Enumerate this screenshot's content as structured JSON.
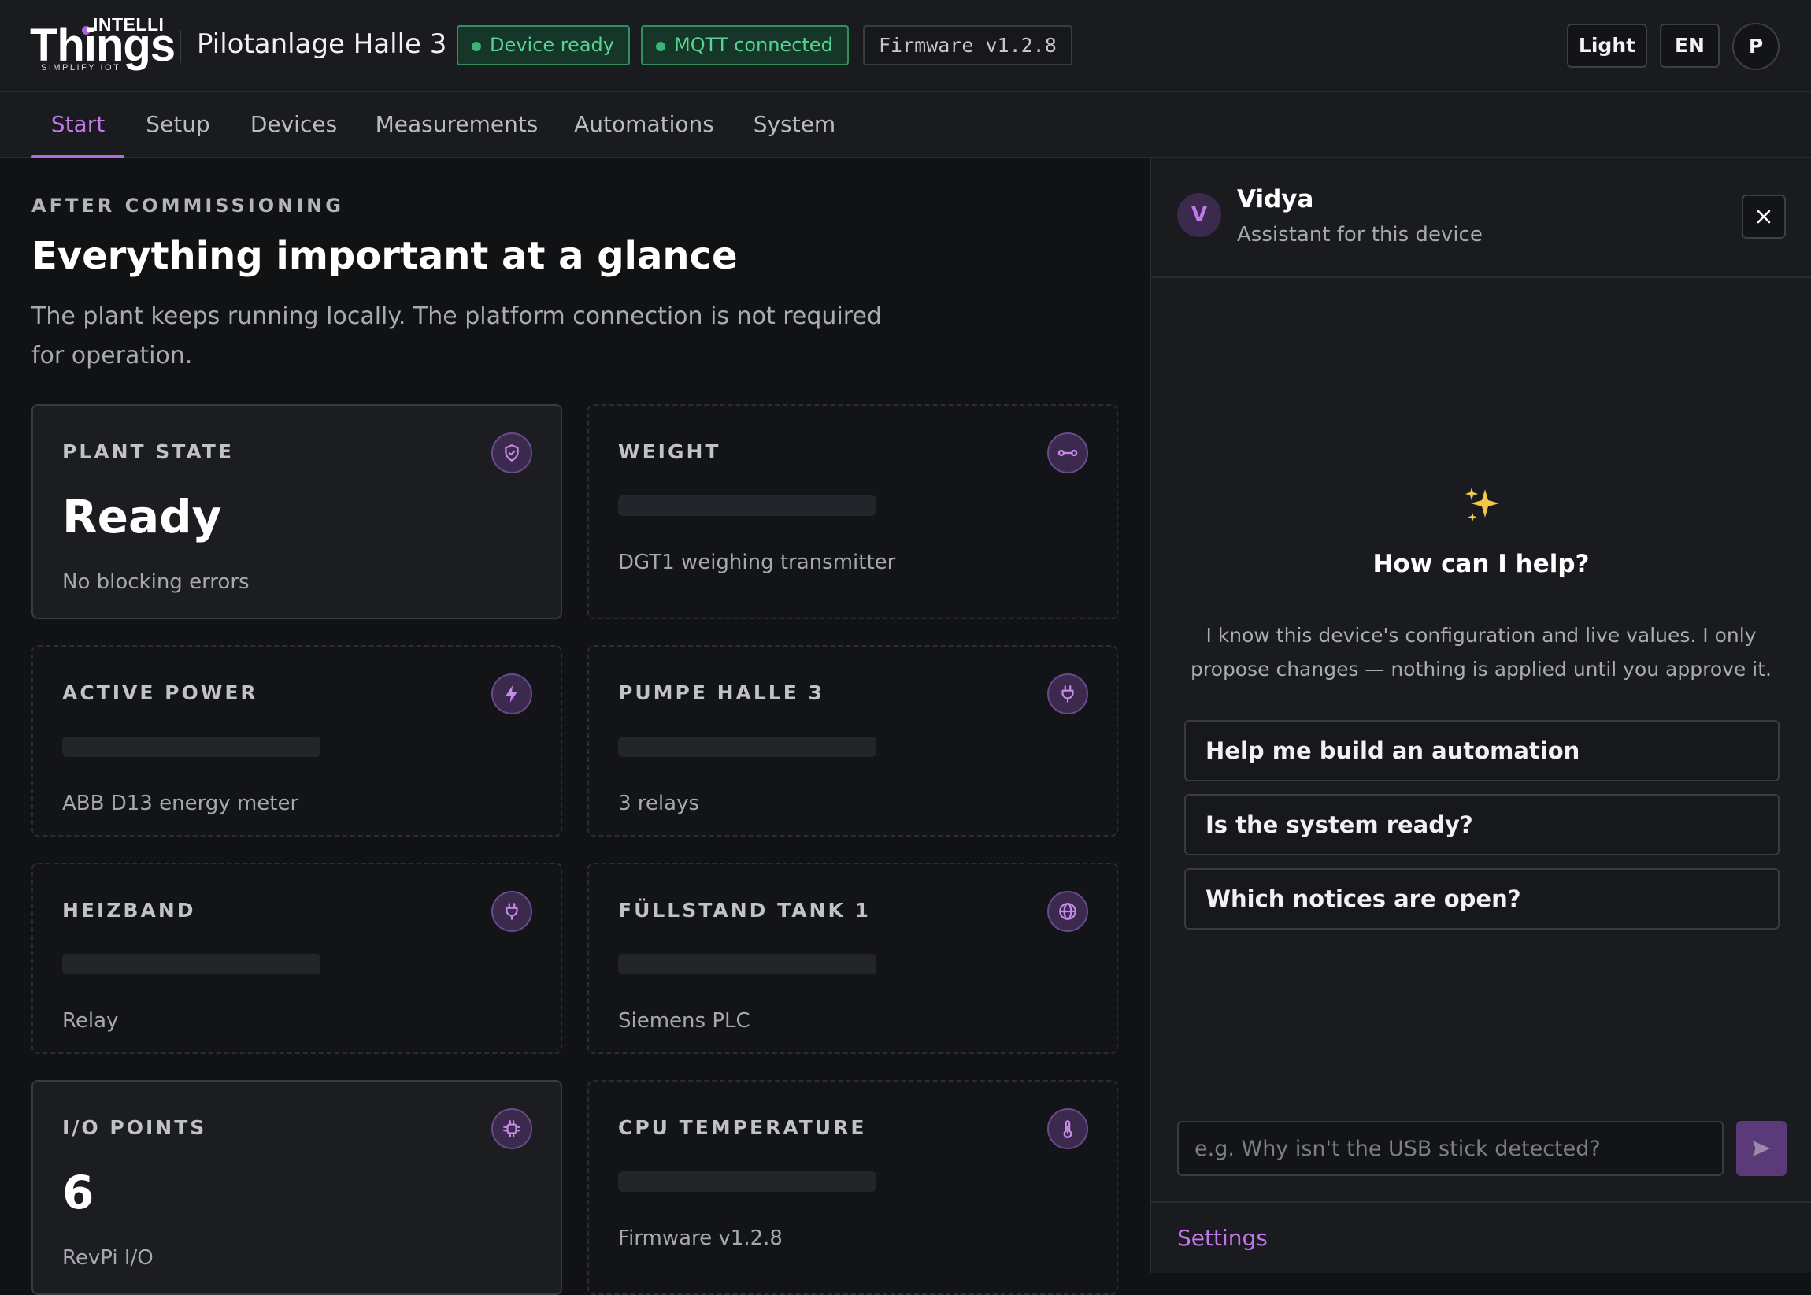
{
  "header": {
    "logo": {
      "brand_top": "INTELLI",
      "brand_main": "Things",
      "tagline": "SIMPLIFY IOT",
      "accent_color": "#a866d8"
    },
    "device_title": "Pilotanlage Halle 3",
    "chips": {
      "device_status": "Device ready",
      "mqtt_status": "MQTT connected",
      "firmware": "Firmware v1.2.8"
    },
    "theme_label": "Light",
    "language_label": "EN",
    "user_initial": "P"
  },
  "nav": {
    "active": "Start",
    "tabs": [
      "Start",
      "Setup",
      "Devices",
      "Measurements",
      "Automations",
      "System"
    ]
  },
  "main": {
    "eyebrow": "AFTER COMMISSIONING",
    "title": "Everything important at a glance",
    "description": "The plant keeps running locally. The platform connection is not required for operation.",
    "cards": [
      {
        "label": "PLANT STATE",
        "value": "Ready",
        "sub": "No blocking errors",
        "icon": "shield-check-icon"
      },
      {
        "label": "WEIGHT",
        "value": null,
        "sub": "DGT1 weighing transmitter",
        "icon": "link-icon"
      },
      {
        "label": "ACTIVE POWER",
        "value": null,
        "sub": "ABB D13 energy meter",
        "icon": "lightning-icon"
      },
      {
        "label": "PUMPE HALLE 3",
        "value": null,
        "sub": "3 relays",
        "icon": "plug-icon"
      },
      {
        "label": "HEIZBAND",
        "value": null,
        "sub": "Relay",
        "icon": "plug-icon"
      },
      {
        "label": "FÜLLSTAND TANK 1",
        "value": null,
        "sub": "Siemens PLC",
        "icon": "globe-icon"
      },
      {
        "label": "I/O POINTS",
        "value": "6",
        "sub": "RevPi I/O",
        "icon": "chip-icon"
      },
      {
        "label": "CPU TEMPERATURE",
        "value": null,
        "sub": "Firmware v1.2.8",
        "icon": "thermometer-icon"
      }
    ]
  },
  "assistant": {
    "avatar_initial": "V",
    "name": "Vidya",
    "role": "Assistant for this device",
    "sparkle_icon": "sparkles-icon",
    "help_title": "How can I help?",
    "intro": "I know this device's configuration and live values. I only propose changes — nothing is applied until you approve it.",
    "suggestions": [
      "Help me build an automation",
      "Is the system ready?",
      "Which notices are open?"
    ],
    "input_placeholder": "e.g. Why isn't the USB stick detected?",
    "input_value": "",
    "send_icon": "send-arrow-icon",
    "footer_link": "Settings"
  },
  "colors": {
    "accent": "#c377ea",
    "success": "#57d393",
    "background": "#111214",
    "panel": "#1a1b1f"
  }
}
